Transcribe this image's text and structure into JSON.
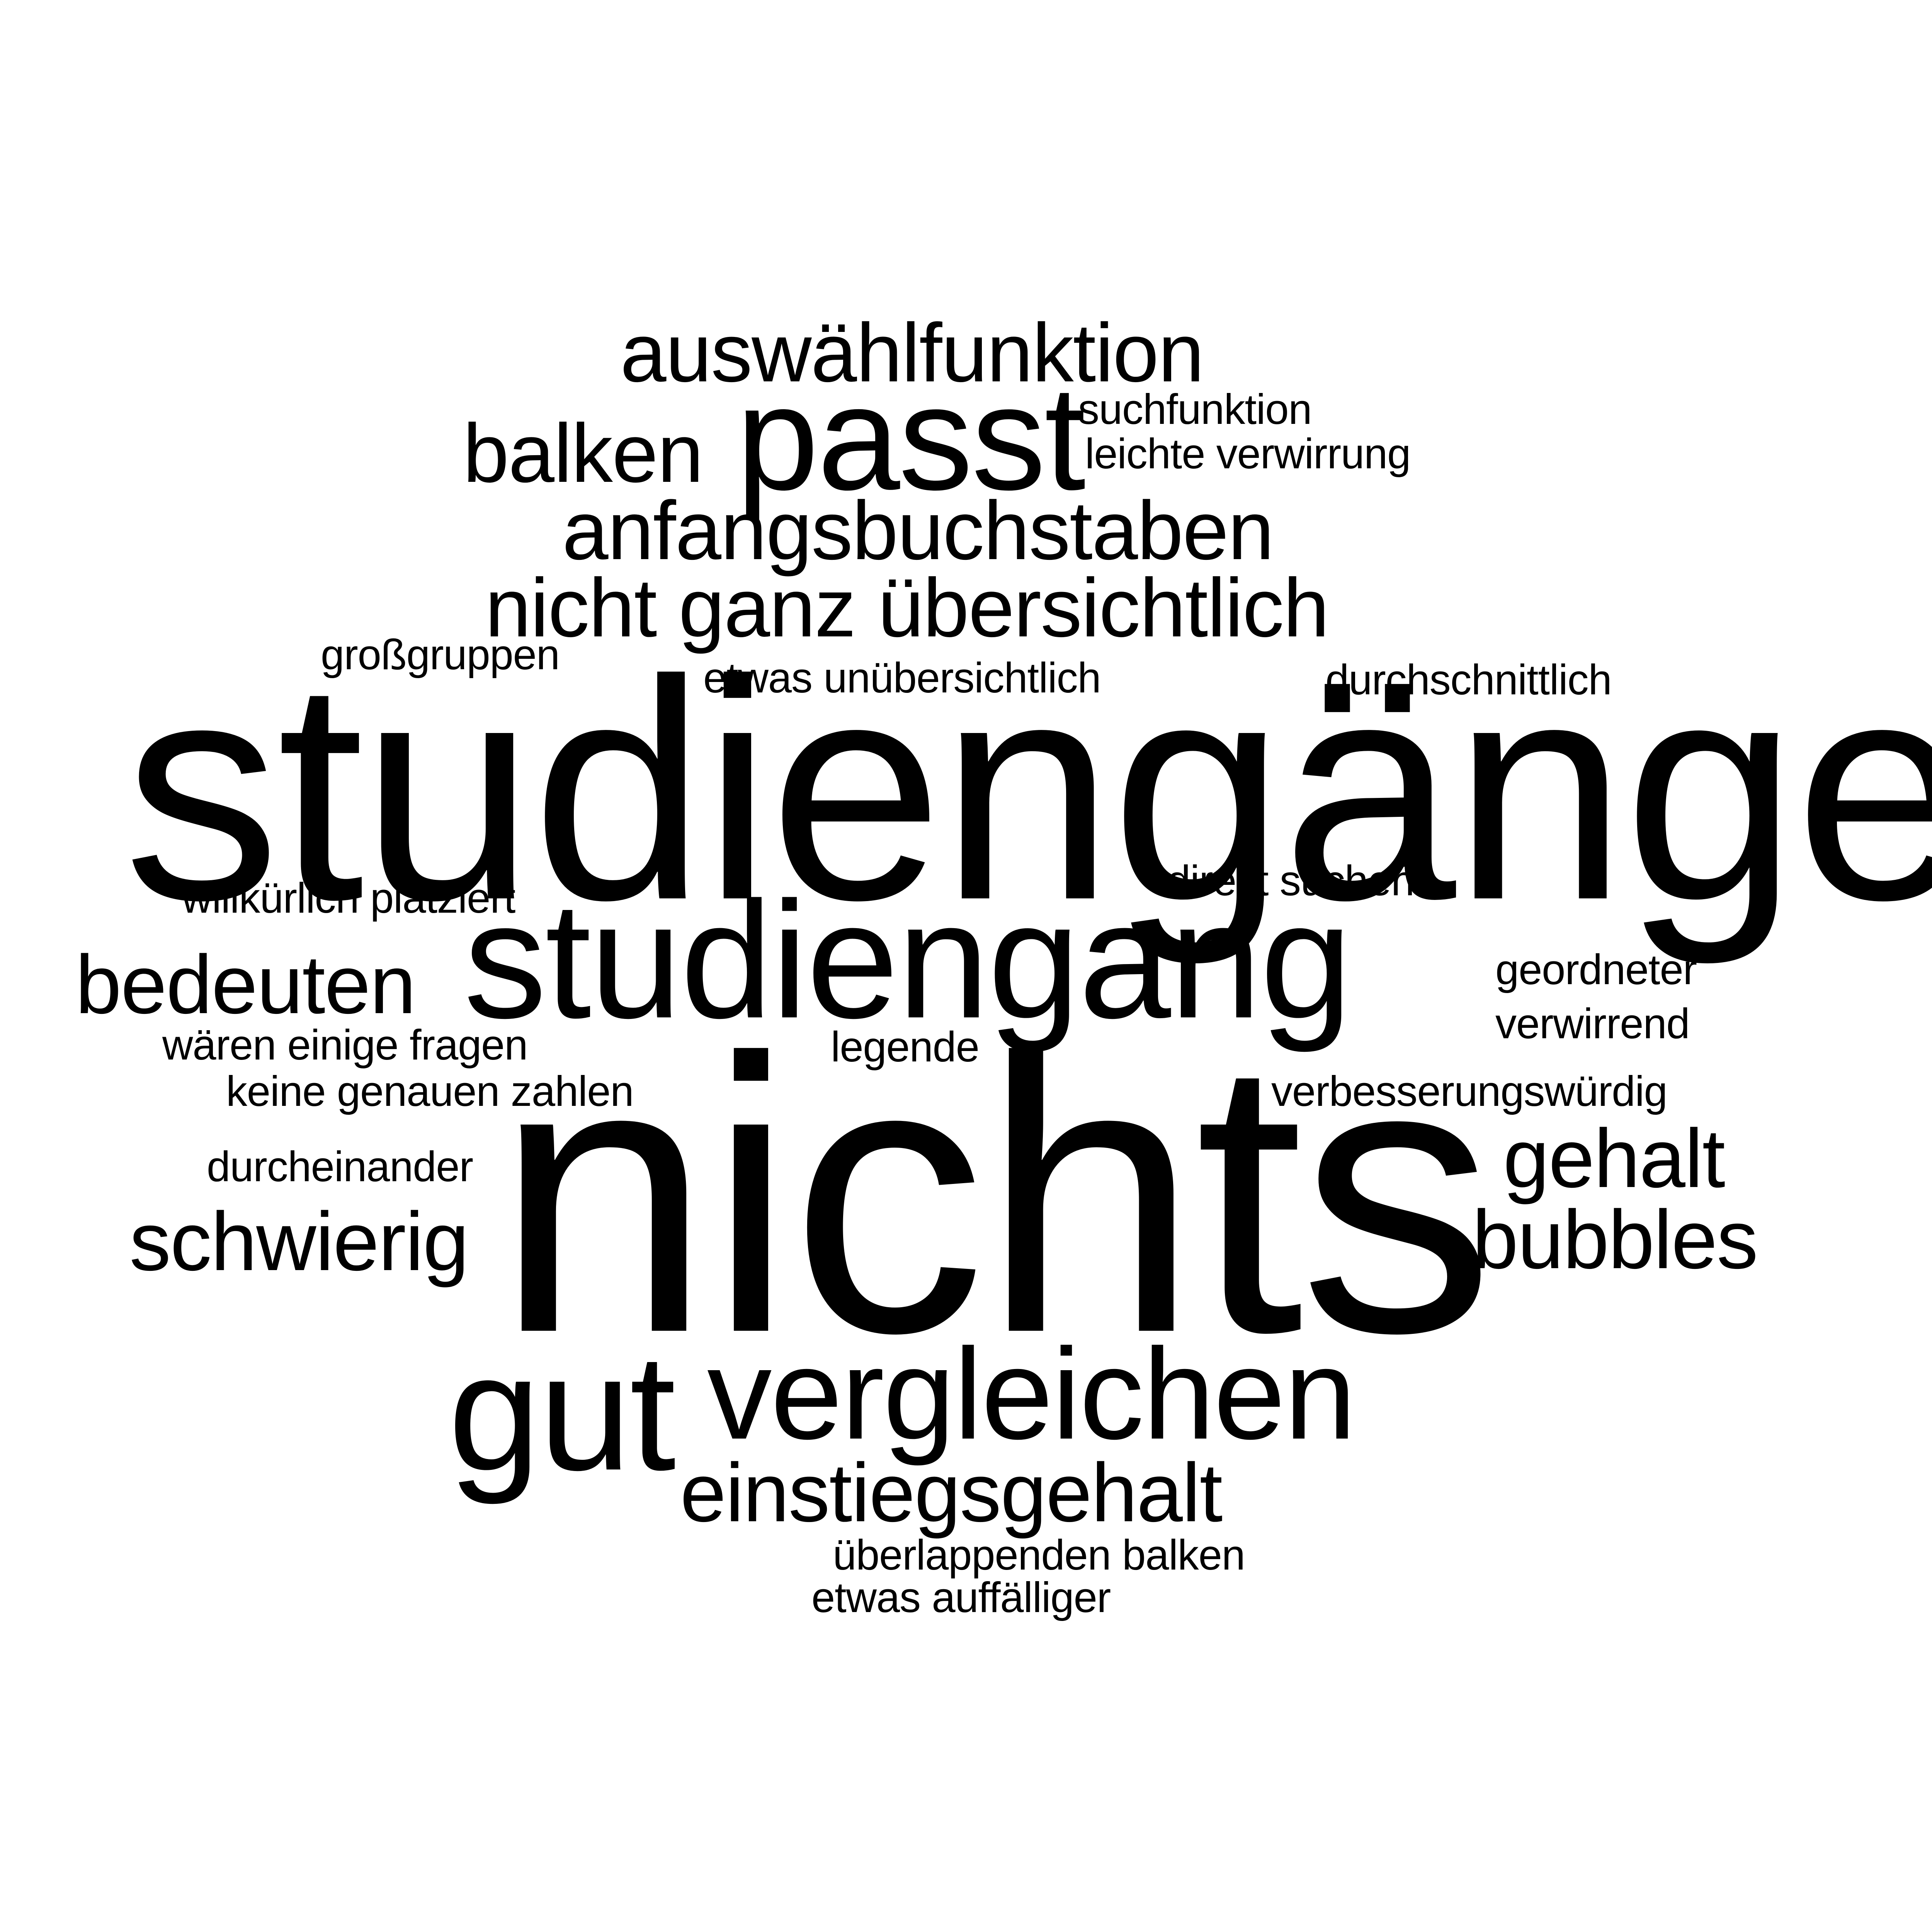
{
  "text_color": "#000000",
  "background_color": "#ffffff",
  "words": [
    {
      "text": "auswählfunktion"
    },
    {
      "text": "passt"
    },
    {
      "text": "balken"
    },
    {
      "text": "suchfunktion"
    },
    {
      "text": "leichte verwirrung"
    },
    {
      "text": "anfangsbuchstaben"
    },
    {
      "text": "nicht ganz übersichtlich"
    },
    {
      "text": "großgruppen"
    },
    {
      "text": "etwas unübersichtlich"
    },
    {
      "text": "durchschnittlich"
    },
    {
      "text": "studiengänge"
    },
    {
      "text": "willkürlich platziert"
    },
    {
      "text": "direkt suchen"
    },
    {
      "text": "studiengang"
    },
    {
      "text": "bedeuten"
    },
    {
      "text": "geordneter"
    },
    {
      "text": "verwirrend"
    },
    {
      "text": "wären einige fragen"
    },
    {
      "text": "legende"
    },
    {
      "text": "keine genauen zahlen"
    },
    {
      "text": "verbesserungswürdig"
    },
    {
      "text": "nichts"
    },
    {
      "text": "gehalt"
    },
    {
      "text": "durcheinander"
    },
    {
      "text": "schwierig"
    },
    {
      "text": "bubbles"
    },
    {
      "text": "gut"
    },
    {
      "text": "vergleichen"
    },
    {
      "text": "einstiegsgehalt"
    },
    {
      "text": "überlappenden balken"
    },
    {
      "text": "etwas auffälliger"
    }
  ]
}
